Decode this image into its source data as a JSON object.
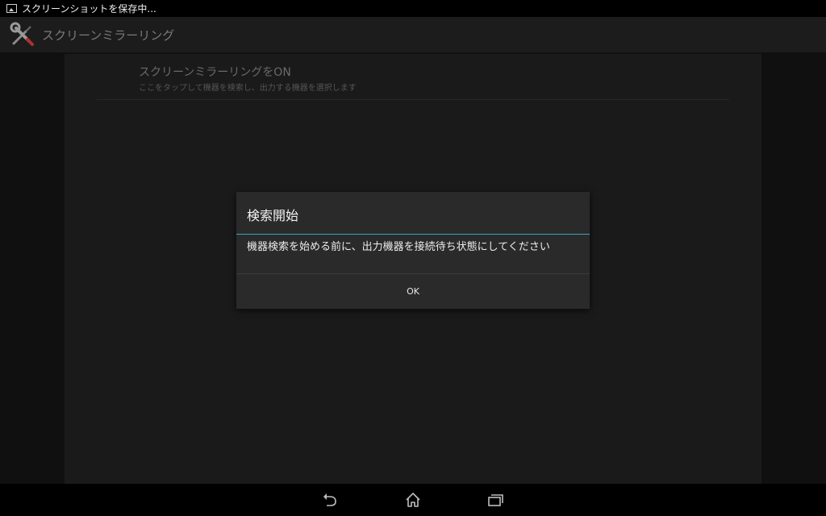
{
  "status_bar": {
    "notification_icon": "image-icon",
    "text": "スクリーンショットを保存中..."
  },
  "action_bar": {
    "icon": "wrench-screwdriver-icon",
    "title": "スクリーンミラーリング"
  },
  "setting": {
    "title": "スクリーンミラーリングをON",
    "summary": "ここをタップして機器を検索し、出力する機器を選択します"
  },
  "dialog": {
    "title": "検索開始",
    "message": "機器検索を始める前に、出力機器を接続待ち状態にしてください",
    "ok_label": "OK"
  },
  "nav_bar": {
    "back_icon": "back-icon",
    "home_icon": "home-icon",
    "recents_icon": "recent-apps-icon"
  },
  "colors": {
    "accent": "#3aa0c8",
    "dialog_bg": "#2a2a2a",
    "panel_bg": "#1a1a1a"
  }
}
